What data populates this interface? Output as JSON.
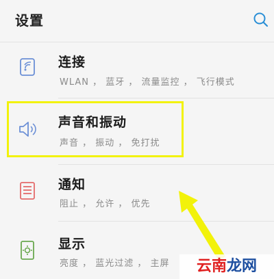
{
  "header": {
    "title": "设置"
  },
  "items": [
    {
      "title": "连接",
      "subtitle": "WLAN ， 蓝牙 ， 流量监控 ， 飞行模式",
      "icon": "connection-icon"
    },
    {
      "title": "声音和振动",
      "subtitle": "声音 ， 振动 ， 免打扰",
      "icon": "speaker-icon"
    },
    {
      "title": "通知",
      "subtitle": "阻止 ， 允许 ， 优先",
      "icon": "notification-icon"
    },
    {
      "title": "显示",
      "subtitle": "亮度 ， 蓝光过滤 ， 主屏",
      "icon": "display-icon"
    }
  ],
  "watermark": {
    "part1": "云南",
    "part2": "龙网"
  },
  "colors": {
    "highlight": "#f2f20a",
    "icon_blue": "#6b8fd6",
    "icon_red": "#e46a6a",
    "icon_green": "#6aa84f"
  }
}
